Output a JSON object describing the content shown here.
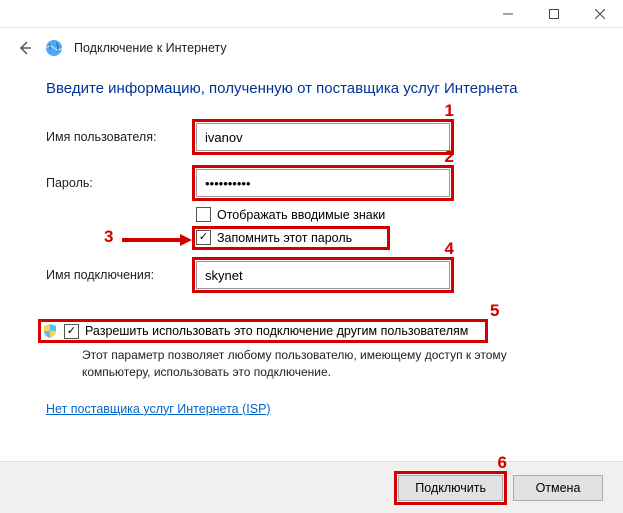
{
  "title": "Подключение к Интернету",
  "heading": "Введите информацию, полученную от поставщика услуг Интернета",
  "labels": {
    "username": "Имя пользователя:",
    "password": "Пароль:",
    "connection": "Имя подключения:"
  },
  "fields": {
    "username": "ivanov",
    "password": "••••••••••",
    "connection": "skynet"
  },
  "checkboxes": {
    "show_chars_label": "Отображать вводимые знаки",
    "show_chars_checked": false,
    "remember_label": "Запомнить этот пароль",
    "remember_checked": true,
    "share_label": "Разрешить использовать это подключение другим пользователям",
    "share_checked": true
  },
  "share_desc": "Этот параметр позволяет любому пользователю, имеющему доступ к этому компьютеру, использовать это подключение.",
  "isp_link": "Нет поставщика услуг Интернета (ISP)",
  "buttons": {
    "connect": "Подключить",
    "cancel": "Отмена"
  },
  "callouts": {
    "c1": "1",
    "c2": "2",
    "c3": "3",
    "c4": "4",
    "c5": "5",
    "c6": "6"
  },
  "checkmark": "✓"
}
